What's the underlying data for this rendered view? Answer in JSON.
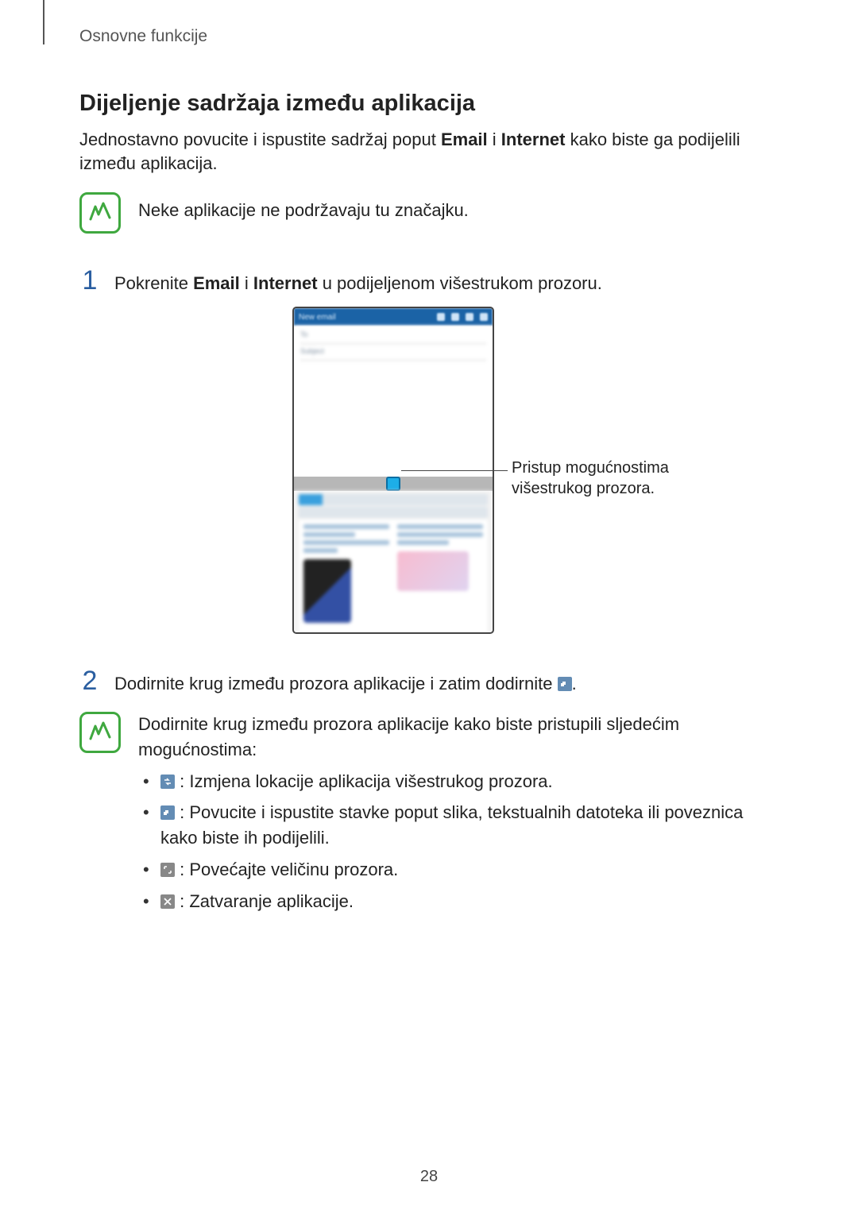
{
  "header": {
    "running": "Osnovne funkcije"
  },
  "section": {
    "title": "Dijeljenje sadržaja između aplikacija",
    "intro_pre": "Jednostavno povucite i ispustite sadržaj poput ",
    "intro_b1": "Email",
    "intro_mid": " i ",
    "intro_b2": "Internet",
    "intro_post": " kako biste ga podijelili između aplikacija."
  },
  "note1": "Neke aplikacije ne podržavaju tu značajku.",
  "step1": {
    "num": "1",
    "pre": "Pokrenite ",
    "b1": "Email",
    "mid": " i ",
    "b2": "Internet",
    "post": " u podijeljenom višestrukom prozoru."
  },
  "figure": {
    "callout": "Pristup mogućnostima višestrukog prozora.",
    "email_title": "New email",
    "to": "To",
    "subject": "Subject"
  },
  "step2": {
    "num": "2",
    "text": "Dodirnite krug između prozora aplikacije i zatim dodirnite "
  },
  "options": {
    "intro": "Dodirnite krug između prozora aplikacije kako biste pristupili sljedećim mogućnostima:",
    "swap": " : Izmjena lokacije aplikacija višestrukog prozora.",
    "move": " : Povucite i ispustite stavke poput slika, tekstualnih datoteka ili poveznica kako biste ih podijelili.",
    "max": " : Povećajte veličinu prozora.",
    "close": " : Zatvaranje aplikacije."
  },
  "page_number": "28"
}
